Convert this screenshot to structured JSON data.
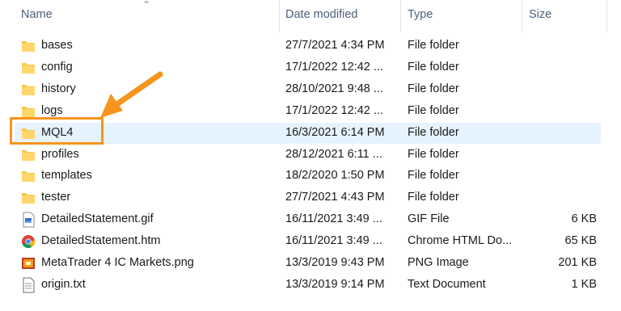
{
  "columns": {
    "name": "Name",
    "date": "Date modified",
    "type": "Type",
    "size": "Size"
  },
  "files": [
    {
      "name": "bases",
      "date": "27/7/2021 4:34 PM",
      "type": "File folder",
      "size": "",
      "icon": "folder-icon"
    },
    {
      "name": "config",
      "date": "17/1/2022 12:42 ...",
      "type": "File folder",
      "size": "",
      "icon": "folder-icon"
    },
    {
      "name": "history",
      "date": "28/10/2021 9:48 ...",
      "type": "File folder",
      "size": "",
      "icon": "folder-icon"
    },
    {
      "name": "logs",
      "date": "17/1/2022 12:42 ...",
      "type": "File folder",
      "size": "",
      "icon": "folder-icon"
    },
    {
      "name": "MQL4",
      "date": "16/3/2021 6:14 PM",
      "type": "File folder",
      "size": "",
      "icon": "folder-icon",
      "selected": true
    },
    {
      "name": "profiles",
      "date": "28/12/2021 6:11 ...",
      "type": "File folder",
      "size": "",
      "icon": "folder-icon"
    },
    {
      "name": "templates",
      "date": "18/2/2020 1:50 PM",
      "type": "File folder",
      "size": "",
      "icon": "folder-icon"
    },
    {
      "name": "tester",
      "date": "27/7/2021 4:43 PM",
      "type": "File folder",
      "size": "",
      "icon": "folder-icon"
    },
    {
      "name": "DetailedStatement.gif",
      "date": "16/11/2021 3:49 ...",
      "type": "GIF File",
      "size": "6 KB",
      "icon": "gif-file-icon"
    },
    {
      "name": "DetailedStatement.htm",
      "date": "16/11/2021 3:49 ...",
      "type": "Chrome HTML Do...",
      "size": "65 KB",
      "icon": "chrome-icon"
    },
    {
      "name": "MetaTrader 4 IC Markets.png",
      "date": "13/3/2019 9:43 PM",
      "type": "PNG Image",
      "size": "201 KB",
      "icon": "png-file-icon"
    },
    {
      "name": "origin.txt",
      "date": "13/3/2019 9:14 PM",
      "type": "Text Document",
      "size": "1 KB",
      "icon": "text-file-icon"
    }
  ],
  "colors": {
    "accent": "#f7941d",
    "selection": "#e5f3ff",
    "header_text": "#4c607a"
  }
}
